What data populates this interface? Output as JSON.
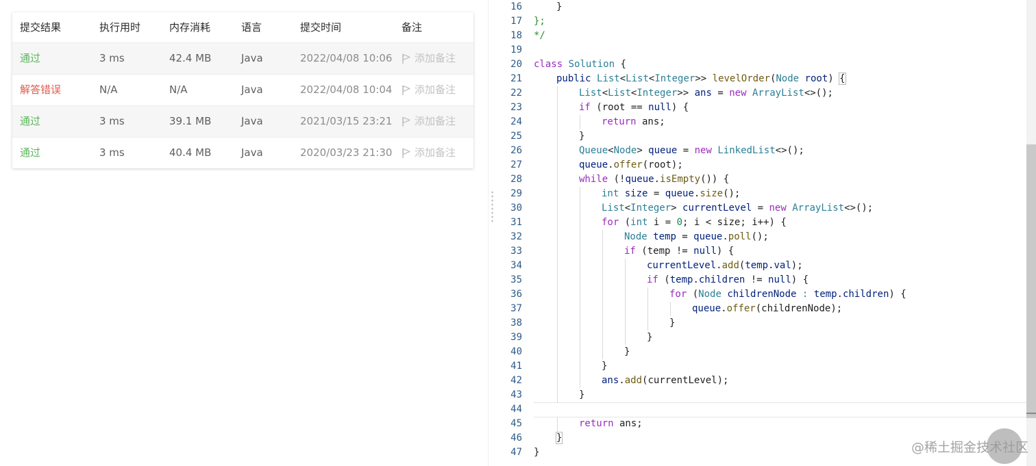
{
  "submissions": {
    "headers": [
      "提交结果",
      "执行用时",
      "内存消耗",
      "语言",
      "提交时间",
      "备注"
    ],
    "rows": [
      {
        "result": "通过",
        "status": "pass",
        "runtime": "3 ms",
        "memory": "42.4 MB",
        "language": "Java",
        "time": "2022/04/08 10:06",
        "note": "添加备注"
      },
      {
        "result": "解答错误",
        "status": "fail",
        "runtime": "N/A",
        "memory": "N/A",
        "language": "Java",
        "time": "2022/04/08 10:04",
        "note": "添加备注"
      },
      {
        "result": "通过",
        "status": "pass",
        "runtime": "3 ms",
        "memory": "39.1 MB",
        "language": "Java",
        "time": "2021/03/15 23:21",
        "note": "添加备注"
      },
      {
        "result": "通过",
        "status": "pass",
        "runtime": "3 ms",
        "memory": "40.4 MB",
        "language": "Java",
        "time": "2020/03/23 21:30",
        "note": "添加备注"
      }
    ]
  },
  "colors": {
    "pass": "#5cb85c",
    "fail": "#e05b4b"
  },
  "icons": {
    "note": "flag-icon"
  },
  "editor": {
    "active_line": 44,
    "lines": [
      {
        "n": 16,
        "indent": 1,
        "t": [
          [
            "p",
            "}"
          ]
        ]
      },
      {
        "n": 17,
        "indent": 0,
        "t": [
          [
            "c",
            "};"
          ]
        ]
      },
      {
        "n": 18,
        "indent": 0,
        "t": [
          [
            "c",
            "*/"
          ]
        ]
      },
      {
        "n": 19,
        "indent": 0,
        "t": []
      },
      {
        "n": 20,
        "indent": 0,
        "t": [
          [
            "k",
            "class"
          ],
          [
            "p",
            " "
          ],
          [
            "t",
            "Solution"
          ],
          [
            "p",
            " {"
          ]
        ]
      },
      {
        "n": 21,
        "indent": 1,
        "t": [
          [
            "v",
            "public"
          ],
          [
            "p",
            " "
          ],
          [
            "t",
            "List"
          ],
          [
            "p",
            "<"
          ],
          [
            "t",
            "List"
          ],
          [
            "p",
            "<"
          ],
          [
            "t",
            "Integer"
          ],
          [
            "p",
            ">> "
          ],
          [
            "f",
            "levelOrder"
          ],
          [
            "p",
            "("
          ],
          [
            "t",
            "Node"
          ],
          [
            "p",
            " "
          ],
          [
            "v",
            "root"
          ],
          [
            "p",
            ") {"
          ]
        ]
      },
      {
        "n": 22,
        "indent": 2,
        "t": [
          [
            "t",
            "List"
          ],
          [
            "p",
            "<"
          ],
          [
            "t",
            "List"
          ],
          [
            "p",
            "<"
          ],
          [
            "t",
            "Integer"
          ],
          [
            "p",
            ">> "
          ],
          [
            "v",
            "ans"
          ],
          [
            "p",
            " = "
          ],
          [
            "k",
            "new"
          ],
          [
            "p",
            " "
          ],
          [
            "t",
            "ArrayList"
          ],
          [
            "p",
            "<>();"
          ]
        ]
      },
      {
        "n": 23,
        "indent": 2,
        "t": [
          [
            "k",
            "if"
          ],
          [
            "p",
            " (root == "
          ],
          [
            "v",
            "null"
          ],
          [
            "p",
            ") {"
          ]
        ]
      },
      {
        "n": 24,
        "indent": 3,
        "t": [
          [
            "k",
            "return"
          ],
          [
            "p",
            " ans;"
          ]
        ]
      },
      {
        "n": 25,
        "indent": 2,
        "t": [
          [
            "p",
            "}"
          ]
        ]
      },
      {
        "n": 26,
        "indent": 2,
        "t": [
          [
            "t",
            "Queue"
          ],
          [
            "p",
            "<"
          ],
          [
            "t",
            "Node"
          ],
          [
            "p",
            "> "
          ],
          [
            "v",
            "queue"
          ],
          [
            "p",
            " = "
          ],
          [
            "k",
            "new"
          ],
          [
            "p",
            " "
          ],
          [
            "t",
            "LinkedList"
          ],
          [
            "p",
            "<>();"
          ]
        ]
      },
      {
        "n": 27,
        "indent": 2,
        "t": [
          [
            "v",
            "queue"
          ],
          [
            "p",
            "."
          ],
          [
            "f",
            "offer"
          ],
          [
            "p",
            "(root);"
          ]
        ]
      },
      {
        "n": 28,
        "indent": 2,
        "t": [
          [
            "k",
            "while"
          ],
          [
            "p",
            " (!"
          ],
          [
            "v",
            "queue"
          ],
          [
            "p",
            "."
          ],
          [
            "f",
            "isEmpty"
          ],
          [
            "p",
            "()) {"
          ]
        ]
      },
      {
        "n": 29,
        "indent": 3,
        "t": [
          [
            "t",
            "int"
          ],
          [
            "p",
            " "
          ],
          [
            "v",
            "size"
          ],
          [
            "p",
            " = "
          ],
          [
            "v",
            "queue"
          ],
          [
            "p",
            "."
          ],
          [
            "f",
            "size"
          ],
          [
            "p",
            "();"
          ]
        ]
      },
      {
        "n": 30,
        "indent": 3,
        "t": [
          [
            "t",
            "List"
          ],
          [
            "p",
            "<"
          ],
          [
            "t",
            "Integer"
          ],
          [
            "p",
            "> "
          ],
          [
            "v",
            "currentLevel"
          ],
          [
            "p",
            " = "
          ],
          [
            "k",
            "new"
          ],
          [
            "p",
            " "
          ],
          [
            "t",
            "ArrayList"
          ],
          [
            "p",
            "<>();"
          ]
        ]
      },
      {
        "n": 31,
        "indent": 3,
        "t": [
          [
            "k",
            "for"
          ],
          [
            "p",
            " ("
          ],
          [
            "t",
            "int"
          ],
          [
            "p",
            " i = "
          ],
          [
            "n",
            "0"
          ],
          [
            "p",
            "; i < size; i++) {"
          ]
        ]
      },
      {
        "n": 32,
        "indent": 4,
        "t": [
          [
            "t",
            "Node"
          ],
          [
            "p",
            " "
          ],
          [
            "v",
            "temp"
          ],
          [
            "p",
            " = "
          ],
          [
            "v",
            "queue"
          ],
          [
            "p",
            "."
          ],
          [
            "f",
            "poll"
          ],
          [
            "p",
            "();"
          ]
        ]
      },
      {
        "n": 33,
        "indent": 4,
        "t": [
          [
            "k",
            "if"
          ],
          [
            "p",
            " (temp != "
          ],
          [
            "v",
            "null"
          ],
          [
            "p",
            ") {"
          ]
        ]
      },
      {
        "n": 34,
        "indent": 5,
        "t": [
          [
            "v",
            "currentLevel"
          ],
          [
            "p",
            "."
          ],
          [
            "f",
            "add"
          ],
          [
            "p",
            "("
          ],
          [
            "v",
            "temp"
          ],
          [
            "p",
            "."
          ],
          [
            "v",
            "val"
          ],
          [
            "p",
            ");"
          ]
        ]
      },
      {
        "n": 35,
        "indent": 5,
        "t": [
          [
            "k",
            "if"
          ],
          [
            "p",
            " ("
          ],
          [
            "v",
            "temp"
          ],
          [
            "p",
            "."
          ],
          [
            "v",
            "children"
          ],
          [
            "p",
            " != "
          ],
          [
            "v",
            "null"
          ],
          [
            "p",
            ") {"
          ]
        ]
      },
      {
        "n": 36,
        "indent": 6,
        "t": [
          [
            "k",
            "for"
          ],
          [
            "p",
            " ("
          ],
          [
            "t",
            "Node"
          ],
          [
            "p",
            " "
          ],
          [
            "v",
            "childrenNode"
          ],
          [
            "p",
            " "
          ],
          [
            "t",
            ":"
          ],
          [
            "p",
            " "
          ],
          [
            "v",
            "temp"
          ],
          [
            "p",
            "."
          ],
          [
            "v",
            "children"
          ],
          [
            "p",
            ") {"
          ]
        ]
      },
      {
        "n": 37,
        "indent": 7,
        "t": [
          [
            "v",
            "queue"
          ],
          [
            "p",
            "."
          ],
          [
            "f",
            "offer"
          ],
          [
            "p",
            "(childrenNode);"
          ]
        ]
      },
      {
        "n": 38,
        "indent": 6,
        "t": [
          [
            "p",
            "}"
          ]
        ]
      },
      {
        "n": 39,
        "indent": 5,
        "t": [
          [
            "p",
            "}"
          ]
        ]
      },
      {
        "n": 40,
        "indent": 4,
        "t": [
          [
            "p",
            "}"
          ]
        ]
      },
      {
        "n": 41,
        "indent": 3,
        "t": [
          [
            "p",
            "}"
          ]
        ]
      },
      {
        "n": 42,
        "indent": 3,
        "t": [
          [
            "v",
            "ans"
          ],
          [
            "p",
            "."
          ],
          [
            "f",
            "add"
          ],
          [
            "p",
            "(currentLevel);"
          ]
        ]
      },
      {
        "n": 43,
        "indent": 2,
        "t": [
          [
            "p",
            "}"
          ]
        ]
      },
      {
        "n": 44,
        "indent": 0,
        "t": []
      },
      {
        "n": 45,
        "indent": 2,
        "t": [
          [
            "k",
            "return"
          ],
          [
            "p",
            " ans;"
          ]
        ]
      },
      {
        "n": 46,
        "indent": 1,
        "t": [
          [
            "p",
            "}"
          ]
        ]
      },
      {
        "n": 47,
        "indent": 0,
        "t": [
          [
            "p",
            "}"
          ]
        ]
      }
    ]
  },
  "watermark": "@稀土掘金技术社区"
}
